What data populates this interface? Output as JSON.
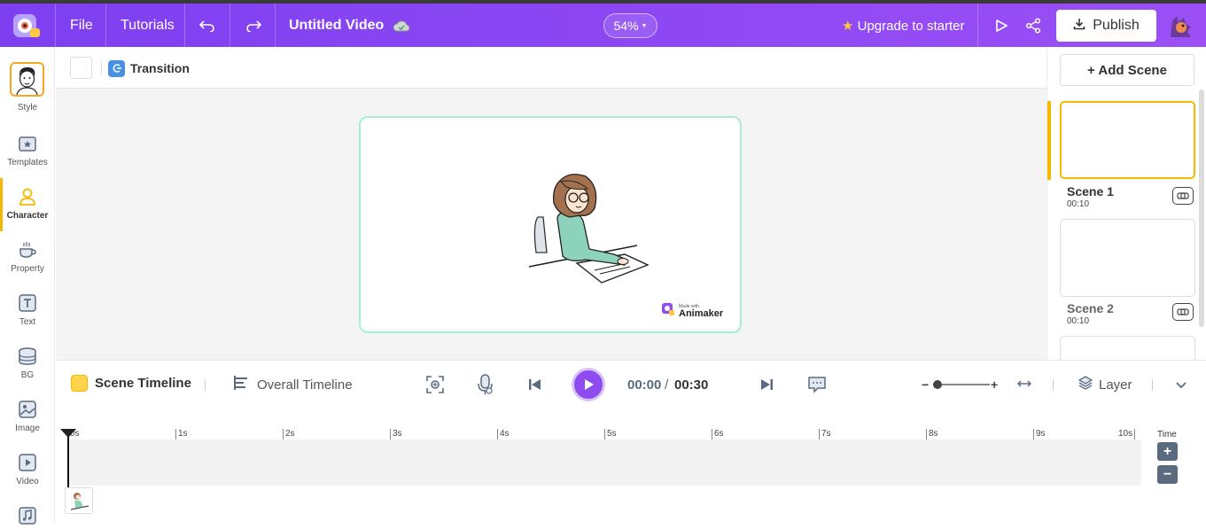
{
  "topbar": {
    "menu_file": "File",
    "menu_tutorials": "Tutorials",
    "title": "Untitled Video",
    "zoom": "54%",
    "upgrade": "Upgrade to starter",
    "publish": "Publish"
  },
  "sidebar": {
    "items": [
      {
        "label": "Style"
      },
      {
        "label": "Templates"
      },
      {
        "label": "Character"
      },
      {
        "label": "Property"
      },
      {
        "label": "Text"
      },
      {
        "label": "BG"
      },
      {
        "label": "Image"
      },
      {
        "label": "Video"
      }
    ]
  },
  "transition": {
    "label": "Transition"
  },
  "stage": {
    "watermark_small": "Made with",
    "watermark_brand": "Animaker"
  },
  "scenes": {
    "add_label": "+ Add Scene",
    "items": [
      {
        "name": "Scene 1",
        "duration": "00:10"
      },
      {
        "name": "Scene 2",
        "duration": "00:10"
      }
    ]
  },
  "timeline": {
    "scene_timeline": "Scene Timeline",
    "overall_timeline": "Overall Timeline",
    "current_time": "00:00",
    "separator": "/",
    "total_time": "00:30",
    "layer": "Layer",
    "time_label": "Time",
    "ticks": [
      "0s",
      "1s",
      "2s",
      "3s",
      "4s",
      "5s",
      "6s",
      "7s",
      "8s",
      "9s",
      "10s"
    ]
  },
  "colors": {
    "brand": "#8e4cf0",
    "accent": "#f5b800",
    "stage_border": "#a8ecd6"
  }
}
